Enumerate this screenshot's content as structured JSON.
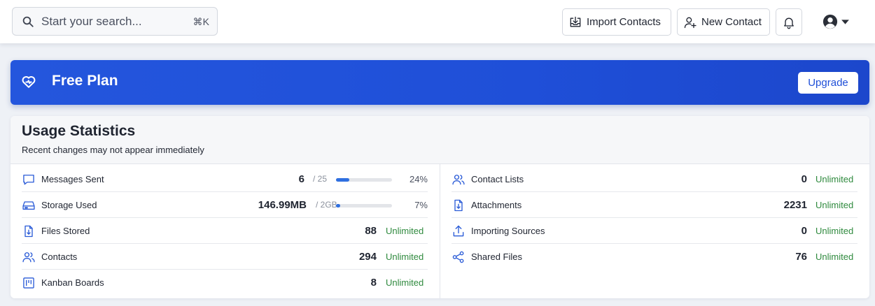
{
  "search": {
    "placeholder": "Start your search...",
    "shortcut": "⌘K",
    "icon": "search-icon"
  },
  "header": {
    "import_label": "Import Contacts",
    "new_contact_label": "New Contact",
    "icons": [
      "import-icon",
      "add-user-icon",
      "bell-icon",
      "account-icon",
      "chevron-down-icon"
    ]
  },
  "plan": {
    "title": "Free Plan",
    "upgrade_label": "Upgrade",
    "accent": "#1f4fd8"
  },
  "usage": {
    "title": "Usage Statistics",
    "subtitle": "Recent changes may not appear immediately",
    "left": [
      {
        "icon": "message-icon",
        "label": "Messages Sent",
        "value": "6",
        "max": "/ 25",
        "progress": 0.24,
        "percent": "24%"
      },
      {
        "icon": "storage-icon",
        "label": "Storage Used",
        "value": "146.99MB",
        "max": "/ 2GB",
        "progress": 0.07,
        "percent": "7%"
      },
      {
        "icon": "file-download-icon",
        "label": "Files Stored",
        "value": "88",
        "limit": "Unlimited"
      },
      {
        "icon": "users-icon",
        "label": "Contacts",
        "value": "294",
        "limit": "Unlimited"
      },
      {
        "icon": "kanban-icon",
        "label": "Kanban Boards",
        "value": "8",
        "limit": "Unlimited"
      }
    ],
    "right": [
      {
        "icon": "users-icon",
        "label": "Contact Lists",
        "value": "0",
        "limit": "Unlimited"
      },
      {
        "icon": "file-download-icon",
        "label": "Attachments",
        "value": "2231",
        "limit": "Unlimited"
      },
      {
        "icon": "upload-icon",
        "label": "Importing Sources",
        "value": "0",
        "limit": "Unlimited"
      },
      {
        "icon": "share-icon",
        "label": "Shared Files",
        "value": "76",
        "limit": "Unlimited"
      }
    ]
  },
  "colors": {
    "unlimited": "#2f8a3e",
    "progress": "#2f6fe0",
    "icon": "#2a5bd7"
  }
}
